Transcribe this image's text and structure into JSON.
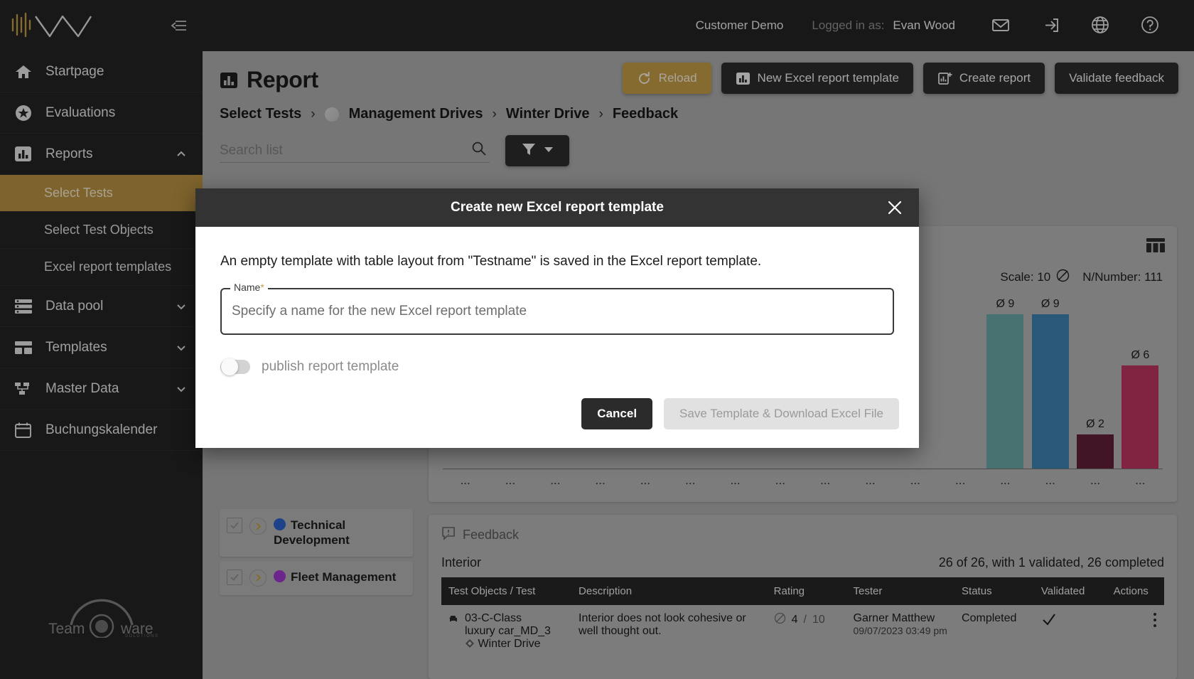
{
  "sidebar": {
    "logo_alt": "waveform-logo",
    "collapse_icon": "collapse-sidebar-icon",
    "items": [
      {
        "label": "Startpage",
        "icon": "home-icon",
        "expandable": false
      },
      {
        "label": "Evaluations",
        "icon": "star-circle-icon",
        "expandable": false
      },
      {
        "label": "Reports",
        "icon": "bar-chart-icon",
        "expandable": true,
        "expanded": true
      },
      {
        "label": "Data pool",
        "icon": "database-list-icon",
        "expandable": true,
        "expanded": false
      },
      {
        "label": "Templates",
        "icon": "layout-icon",
        "expandable": true,
        "expanded": false
      },
      {
        "label": "Master Data",
        "icon": "hierarchy-icon",
        "expandable": true,
        "expanded": false
      },
      {
        "label": "Buchungskalender",
        "icon": "calendar-icon",
        "expandable": false
      }
    ],
    "sub_items": [
      {
        "label": "Select Tests",
        "active": true
      },
      {
        "label": "Select Test Objects",
        "active": false
      },
      {
        "label": "Excel report templates",
        "active": false
      }
    ],
    "footer_logo": {
      "part1": "Team",
      "part2": "ware",
      "sub": "SOLUTIONS"
    }
  },
  "topbar": {
    "customer": "Customer Demo",
    "logged_in_label": "Logged in as:",
    "user": "Evan Wood",
    "icons": [
      "mail-icon",
      "logout-icon",
      "globe-icon",
      "help-icon"
    ]
  },
  "page": {
    "title": "Report",
    "title_icon": "bar-chart-icon",
    "actions": [
      {
        "label": "Reload",
        "icon": "refresh-icon",
        "style": "gold"
      },
      {
        "label": "New Excel report template",
        "icon": "bar-chart-icon",
        "style": "dark"
      },
      {
        "label": "Create report",
        "icon": "chart-plus-icon",
        "style": "dark"
      },
      {
        "label": "Validate feedback",
        "icon": "",
        "style": "dark"
      }
    ],
    "breadcrumb": [
      "Select Tests",
      "Management Drives",
      "Winter Drive",
      "Feedback"
    ],
    "search": {
      "placeholder": "Search list",
      "value": "",
      "icon": "search-icon"
    },
    "filter_button": {
      "icon": "filter-icon",
      "caret": "chevron-down-icon"
    }
  },
  "tree": {
    "items": [
      {
        "label": "Technical Development",
        "dot_color": "#2b5fc4",
        "checkbox": "checkbox-checked-icon",
        "expand": "chevron-right-icon"
      },
      {
        "label": "Fleet Management",
        "dot_color": "#9b35c9",
        "checkbox": "checkbox-checked-icon",
        "expand": "chevron-right-icon"
      }
    ]
  },
  "chart_panel": {
    "toolbar_icon": "table-columns-icon",
    "scale_label": "Scale: 10",
    "scale_icon": "gauge-icon",
    "n_number_label": "N/Number: 111"
  },
  "chart_data": {
    "type": "bar",
    "title": "",
    "xlabel": "",
    "ylabel": "",
    "ylim": [
      0,
      10
    ],
    "grid": false,
    "legend": "none",
    "categories": [
      "...",
      "...",
      "...",
      "...",
      "...",
      "...",
      "...",
      "...",
      "...",
      "...",
      "...",
      "...",
      "...",
      "...",
      "...",
      "..."
    ],
    "values": [
      null,
      null,
      null,
      null,
      null,
      null,
      null,
      null,
      null,
      null,
      null,
      null,
      9,
      9,
      2,
      6
    ],
    "data_labels": [
      "",
      "",
      "",
      "",
      "",
      "",
      "",
      "",
      "",
      "",
      "",
      "",
      "Ø 9",
      "Ø 9",
      "Ø 2",
      "Ø 6"
    ],
    "bar_colors": [
      "",
      "",
      "",
      "",
      "",
      "",
      "",
      "",
      "",
      "",
      "",
      "",
      "#68a3a3",
      "#3b7fae",
      "#5e1f36",
      "#b9345f"
    ]
  },
  "feedback": {
    "header_label": "Feedback",
    "header_icon": "feedback-icon",
    "section_title": "Interior",
    "summary": "26 of 26, with 1 validated, 26 completed",
    "columns": [
      "Test Objects / Test",
      "Description",
      "Rating",
      "Tester",
      "Status",
      "Validated",
      "Actions"
    ],
    "rows": [
      {
        "object_icon": "car-icon",
        "object_line1": "03-C-Class",
        "object_line2": "luxury car_MD_3",
        "drive_icon": "diamond-icon",
        "object_line3": "Winter Drive",
        "description": "Interior does not look cohesive or well thought out.",
        "rating_icon": "gauge-icon",
        "rating_value": "4",
        "rating_sep": "/",
        "rating_max": "10",
        "tester_name": "Garner Matthew",
        "tester_date": "09/07/2023 03:49 pm",
        "status": "Completed",
        "validated_icon": "check-icon",
        "actions_icon": "more-vertical-icon"
      }
    ]
  },
  "modal": {
    "title": "Create new Excel report template",
    "close_icon": "close-icon",
    "description": "An empty template with table layout from \"Testname\" is saved in the Excel report template.",
    "field": {
      "legend": "Name",
      "required_marker": "*",
      "placeholder": "Specify a name for the new Excel report template",
      "value": ""
    },
    "toggle": {
      "label": "publish report template",
      "on": false
    },
    "cancel_label": "Cancel",
    "save_label": "Save Template & Download Excel File"
  },
  "colors": {
    "accent_gold": "#c09a46",
    "dark": "#2b2b2b",
    "sidebar": "#232323"
  }
}
